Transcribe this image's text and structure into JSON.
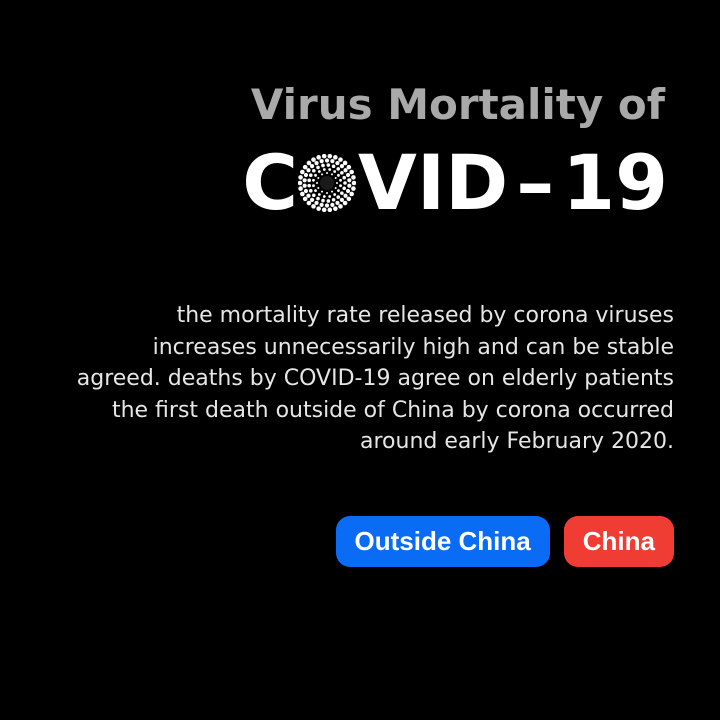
{
  "title": {
    "line1": "Virus Mortality of",
    "line2_prefix": "C",
    "line2_suffix": "VID",
    "line2_dash": "–",
    "line2_number": "19"
  },
  "body": {
    "paragraph": "the mortality rate released by corona viruses increases unnecessarily high and can be stable agreed. deaths by COVID-19 agree on elderly patients the first death outside of China by corona occurred around early February 2020."
  },
  "legend": {
    "items": [
      {
        "label": "Outside China",
        "color": "#0a6cf5"
      },
      {
        "label": "China",
        "color": "#f03d33"
      }
    ]
  },
  "icons": {
    "title_o": "virus-icon"
  }
}
